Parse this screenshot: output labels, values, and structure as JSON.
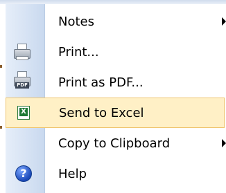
{
  "menu": {
    "items": [
      {
        "label": "Notes",
        "has_submenu": true,
        "icon": ""
      },
      {
        "label": "Print...",
        "has_submenu": false,
        "icon": "printer-icon"
      },
      {
        "label": "Print as PDF...",
        "has_submenu": false,
        "icon": "pdf-printer-icon",
        "icon_badge": "PDF"
      },
      {
        "label": "Send to Excel",
        "has_submenu": false,
        "icon": "excel-icon",
        "icon_glyph": "X",
        "highlighted": true
      },
      {
        "label": "Copy to Clipboard",
        "has_submenu": true,
        "icon": ""
      },
      {
        "label": "Help",
        "has_submenu": false,
        "icon": "help-icon",
        "icon_glyph": "?"
      }
    ]
  },
  "colors": {
    "highlight_bg": "#fff0c6",
    "highlight_border": "#efc46c",
    "gutter_start": "#e6eef9",
    "gutter_end": "#c9d9ef"
  }
}
